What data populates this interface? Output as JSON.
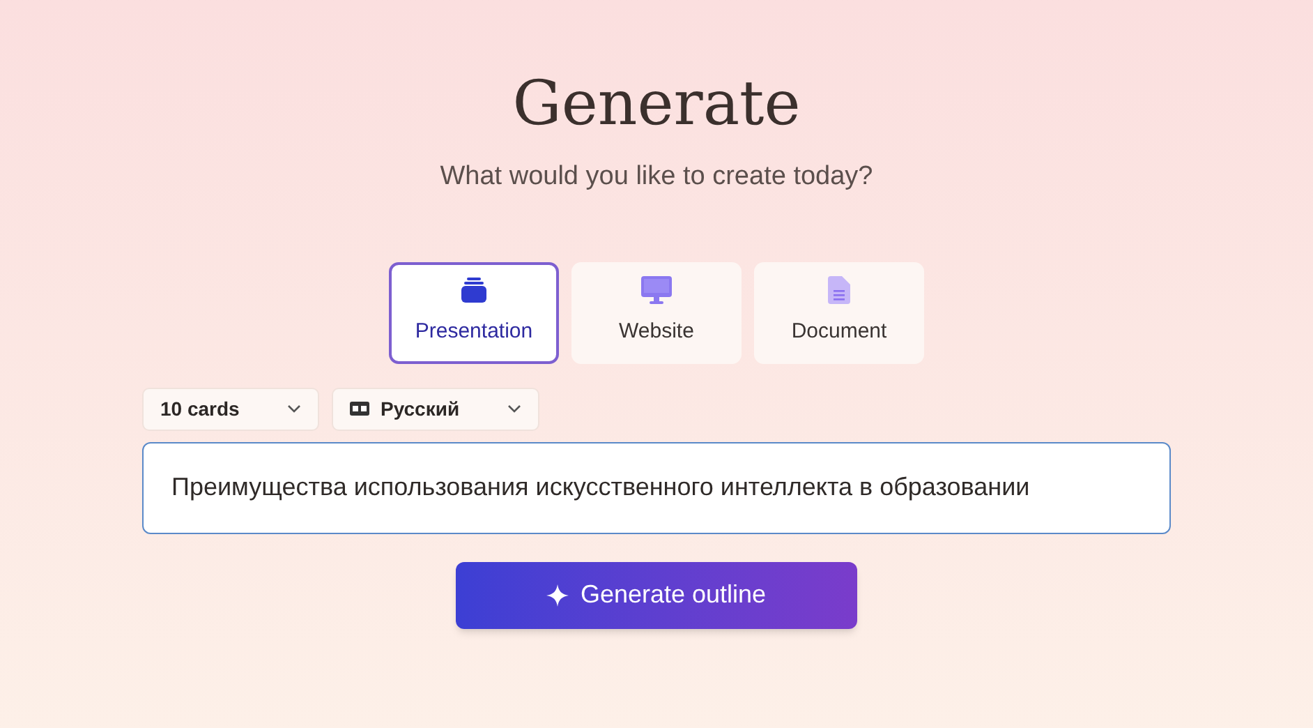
{
  "title": "Generate",
  "subtitle": "What would you like to create today?",
  "tabs": [
    {
      "kind": "presentation",
      "label": "Presentation",
      "selected": true
    },
    {
      "kind": "website",
      "label": "Website",
      "selected": false
    },
    {
      "kind": "document",
      "label": "Document",
      "selected": false
    }
  ],
  "dropdowns": [
    {
      "kind": "count",
      "value": "10 cards"
    },
    {
      "kind": "language",
      "value": "Русский"
    }
  ],
  "prompt": {
    "value": "Преимущества использования искусственного интеллекта в образовании"
  },
  "button": {
    "label": "Generate outline"
  }
}
